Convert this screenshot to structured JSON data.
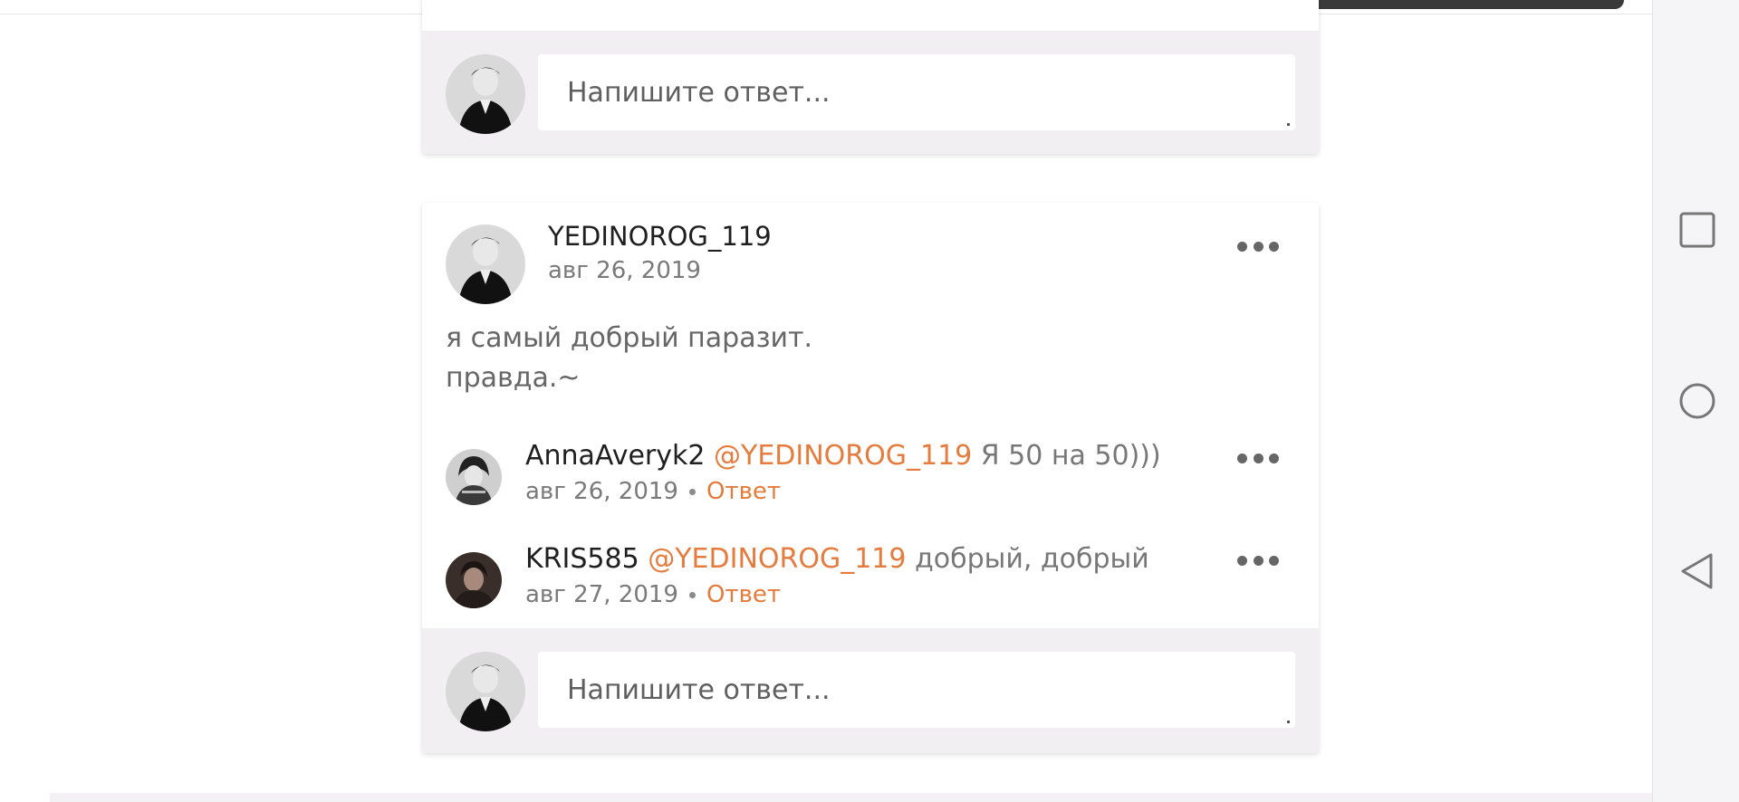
{
  "thread_top": {
    "reply_placeholder": "Напишите ответ..."
  },
  "post": {
    "author": "YEDINOROG_119",
    "date": "авг 26, 2019",
    "text_line1": "я самый добрый паразит.",
    "text_line2": "правда.~",
    "more_icon": "more-horizontal-icon"
  },
  "comments": [
    {
      "author": "AnnaAveryk2",
      "mention": "@YEDINOROG_119",
      "text": " Я 50 на 50)))",
      "date": "авг 26, 2019",
      "reply_label": "Ответ"
    },
    {
      "author": "KRIS585",
      "mention": "@YEDINOROG_119",
      "text": "  добрый, добрый",
      "date": "авг 27, 2019",
      "reply_label": "Ответ"
    }
  ],
  "reply_box": {
    "placeholder": "Напишите ответ..."
  },
  "navigation_bar": {
    "recents_icon": "square-recents-icon",
    "home_icon": "circle-home-icon",
    "back_icon": "triangle-back-icon"
  },
  "colors": {
    "accent": "#e57c3d",
    "reply_bar_bg": "#f1eff2"
  }
}
